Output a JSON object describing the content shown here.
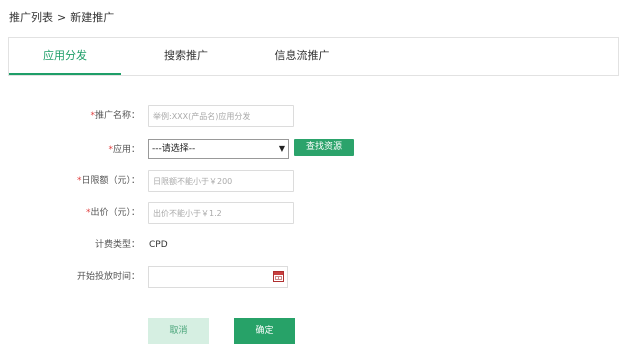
{
  "breadcrumb": {
    "parent": "推广列表",
    "separator": ">",
    "current": "新建推广"
  },
  "tabs": [
    {
      "label": "应用分发",
      "active": true
    },
    {
      "label": "搜索推广",
      "active": false
    },
    {
      "label": "信息流推广",
      "active": false
    }
  ],
  "form": {
    "name": {
      "required_mark": "*",
      "label": "推广名称：",
      "placeholder": "举例:XXX(产品名)应用分发",
      "value": ""
    },
    "app": {
      "required_mark": "*",
      "label": "应用：",
      "selected": "---请选择--",
      "find_button": "查找资源"
    },
    "daily_budget": {
      "required_mark": "*",
      "label": "日限额（元）：",
      "placeholder": "日限额不能小于￥200",
      "value": ""
    },
    "bid": {
      "required_mark": "*",
      "label": "出价（元）：",
      "placeholder": "出价不能小于￥1.2",
      "value": ""
    },
    "billing_type": {
      "label": "计费类型：",
      "value": "CPD"
    },
    "start_time": {
      "label": "开始投放时间：",
      "value": "",
      "icon": "calendar-icon"
    }
  },
  "actions": {
    "cancel": "取消",
    "confirm": "确定"
  },
  "colors": {
    "accent": "#1e9e68",
    "button_green": "#27a268",
    "cancel_bg": "#d6efe2",
    "required": "#e04040"
  }
}
